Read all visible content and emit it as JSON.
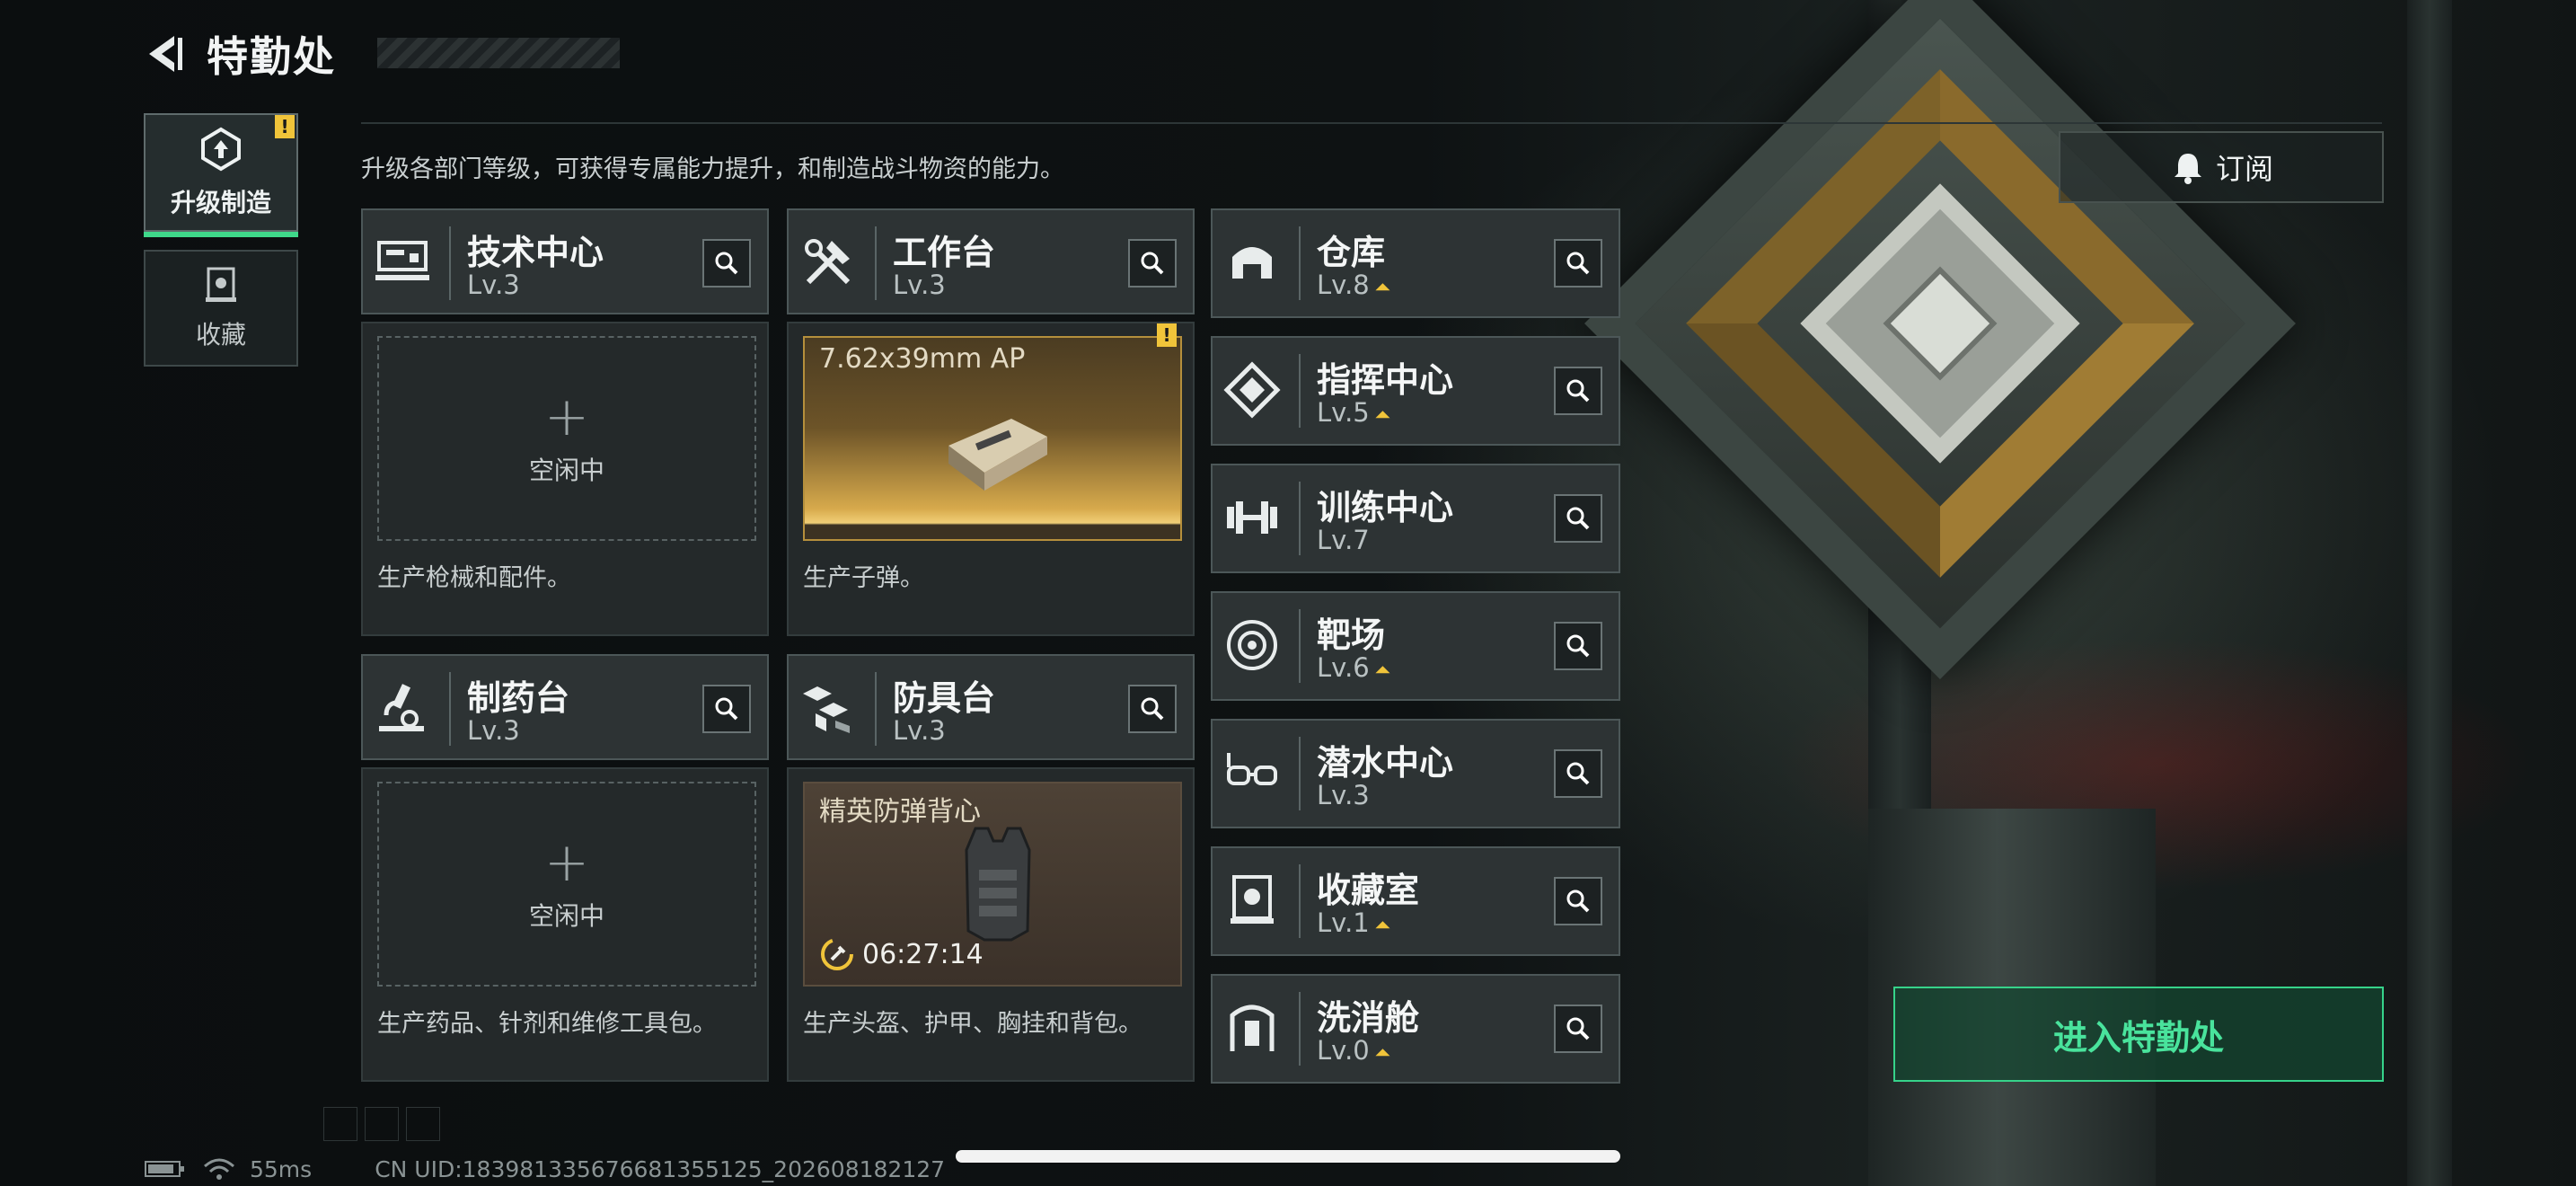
{
  "header": {
    "title": "特勤处",
    "back_icon": "back-arrow-icon"
  },
  "tabs": [
    {
      "label": "升级制造",
      "icon": "upgrade-cube-icon",
      "active": true,
      "badge": "!"
    },
    {
      "label": "收藏",
      "icon": "collection-icon",
      "active": false
    }
  ],
  "description": "升级各部门等级，可获得专属能力提升，和制造战斗物资的能力。",
  "stations": [
    {
      "name": "技术中心",
      "level": "Lv.3",
      "icon": "tech-center-icon",
      "slot_label": "空闲中",
      "desc": "生产枪械和配件。"
    },
    {
      "name": "工作台",
      "level": "Lv.3",
      "icon": "workbench-tools-icon",
      "slot_title": "7.62x39mm AP",
      "badge": "!",
      "desc": "生产子弹。"
    },
    {
      "name": "制药台",
      "level": "Lv.3",
      "icon": "pharmacy-microscope-icon",
      "slot_label": "空闲中",
      "desc": "生产药品、针剂和维修工具包。"
    },
    {
      "name": "防具台",
      "level": "Lv.3",
      "icon": "armor-bench-icon",
      "slot_title": "精英防弹背心",
      "timer": "06:27:14",
      "desc": "生产头盔、护甲、胸挂和背包。"
    }
  ],
  "departments": [
    {
      "name": "仓库",
      "level": "Lv.8",
      "upgradable": true,
      "icon": "warehouse-icon"
    },
    {
      "name": "指挥中心",
      "level": "Lv.5",
      "upgradable": true,
      "icon": "command-center-icon"
    },
    {
      "name": "训练中心",
      "level": "Lv.7",
      "upgradable": false,
      "icon": "dumbbell-icon"
    },
    {
      "name": "靶场",
      "level": "Lv.6",
      "upgradable": true,
      "icon": "target-range-icon"
    },
    {
      "name": "潜水中心",
      "level": "Lv.3",
      "upgradable": false,
      "icon": "diving-goggles-icon"
    },
    {
      "name": "收藏室",
      "level": "Lv.1",
      "upgradable": true,
      "icon": "collection-room-icon"
    },
    {
      "name": "洗消舱",
      "level": "Lv.0",
      "upgradable": true,
      "icon": "decon-chamber-icon"
    }
  ],
  "subscribe_label": "订阅",
  "enter_label": "进入特勤处",
  "status": {
    "ping": "55ms",
    "uid": "CN UID:18398133567668135512​5_202608182127"
  },
  "colors": {
    "accent": "#3fd88a",
    "warning": "#f0c43a",
    "panel": "#2d3334"
  }
}
